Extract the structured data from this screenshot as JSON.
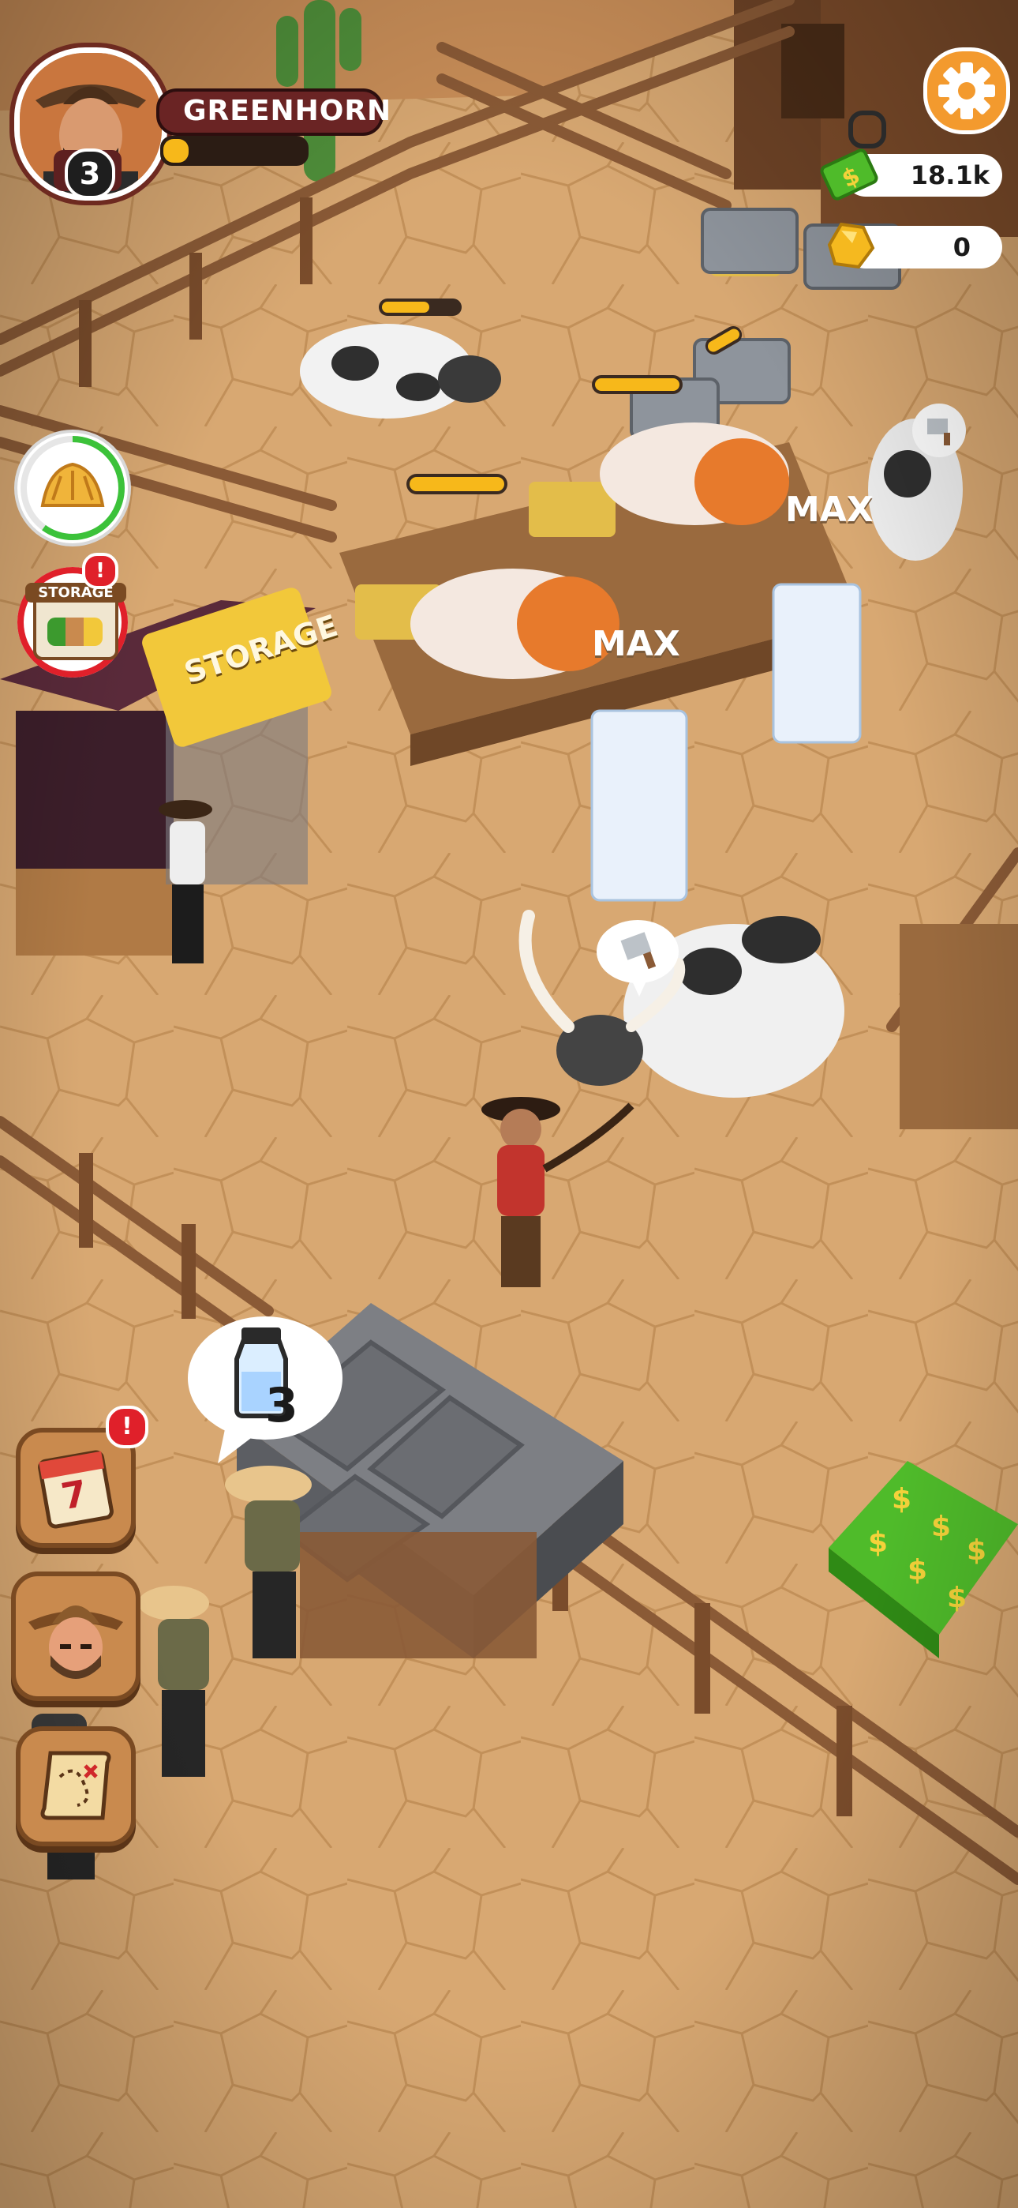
{
  "player": {
    "level": "3",
    "rank": "GREENHORN",
    "xp_progress": 0.18,
    "avatar_icon": "cowboy-portrait-icon"
  },
  "currencies": {
    "cash": {
      "value": "18.1k",
      "icon": "cash-icon"
    },
    "gold": {
      "value": "0",
      "icon": "gold-nugget-icon"
    }
  },
  "settings": {
    "icon": "gear-icon"
  },
  "side_buttons": {
    "hay": {
      "icon": "hay-icon",
      "progress": 0.6
    },
    "storage": {
      "label": "STORAGE",
      "badge": "!"
    }
  },
  "world": {
    "storage_sign": "STORAGE",
    "max_labels": [
      "MAX",
      "MAX"
    ],
    "milk_order": {
      "icon": "milk-bottle-icon",
      "count": "3"
    },
    "butcher_icon": "cleaver-icon"
  },
  "bottom_buttons": {
    "calendar": {
      "day": "7",
      "badge": "!"
    },
    "character": {
      "icon": "cowboy-face-icon"
    },
    "map": {
      "icon": "treasure-map-icon"
    }
  },
  "colors": {
    "ground": "#d6a670",
    "fence": "#8a5a36",
    "accent_orange": "#f39a2e",
    "progress_yellow": "#f7b81a",
    "badge_red": "#e0202a"
  }
}
